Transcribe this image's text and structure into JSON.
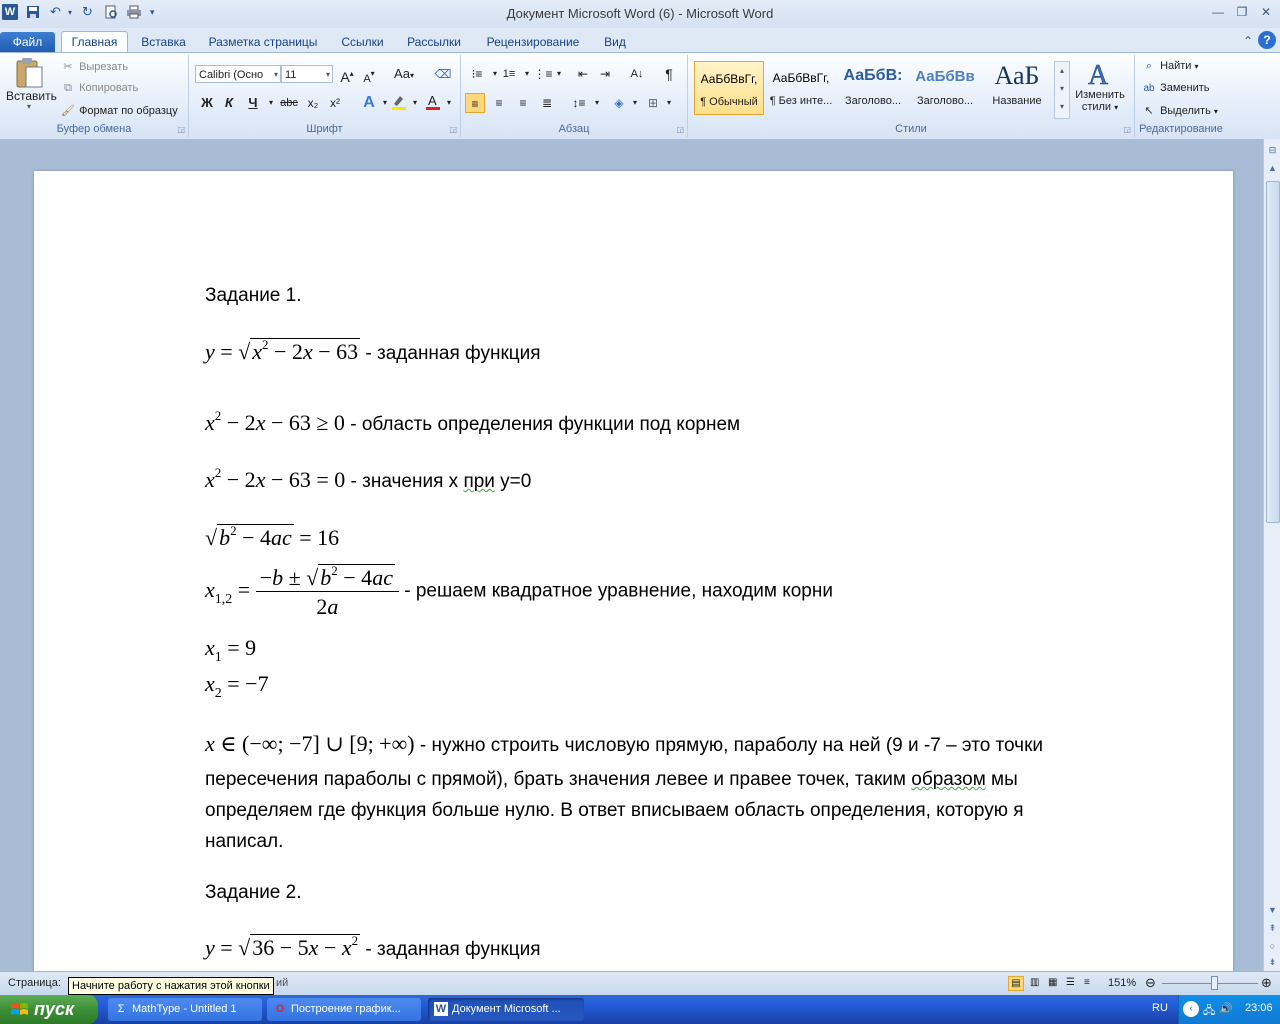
{
  "window": {
    "title": "Документ Microsoft Word (6)  -  Microsoft Word",
    "app_icon": "W",
    "controls": {
      "minimize": "—",
      "restore": "❐",
      "close": "✕"
    }
  },
  "ribbon_tabs": [
    "Файл",
    "Главная",
    "Вставка",
    "Разметка страницы",
    "Ссылки",
    "Рассылки",
    "Рецензирование",
    "Вид"
  ],
  "clipboard": {
    "paste": "Вставить",
    "cut": "Вырезать",
    "copy": "Копировать",
    "format_painter": "Формат по образцу",
    "label": "Буфер обмена"
  },
  "font": {
    "family": "Calibri (Осно",
    "size": "11",
    "label": "Шрифт",
    "bold": "Ж",
    "italic": "К",
    "underline": "Ч",
    "strike": "abc",
    "subscript": "x₂",
    "superscript": "x²",
    "grow": "A",
    "shrink": "A",
    "case": "Aa"
  },
  "paragraph": {
    "label": "Абзац",
    "pilcrow": "¶"
  },
  "styles": {
    "label": "Стили",
    "items": [
      {
        "sample": "АаБбВвГг,",
        "name": "¶ Обычный"
      },
      {
        "sample": "АаБбВвГг,",
        "name": "¶ Без инте..."
      },
      {
        "sample": "АаБбВ:",
        "name": "Заголово..."
      },
      {
        "sample": "АаБбВв",
        "name": "Заголово..."
      },
      {
        "sample": "АаБ",
        "name": "Название"
      }
    ],
    "change": "Изменить стили"
  },
  "editing": {
    "find": "Найти",
    "replace": "Заменить",
    "select": "Выделить",
    "label": "Редактирование"
  },
  "document": {
    "task1_title": "Задание 1.",
    "line1_desc": " - заданная функция",
    "line2_desc": " - область определения функции под корнем",
    "line3_desc_a": " - значения х ",
    "line3_desc_b": "при",
    "line3_desc_c": " у=0",
    "line5_desc": " - решаем квадратное уравнение, находим корни",
    "para_text_1": " - нужно строить числовую прямую, параболу на ней (9 и -7 – это точки",
    "para_text_2a": "пересечения параболы с прямой), брать значения левее и правее точек, таким ",
    "para_text_2b": "образом",
    "para_text_2c": " мы",
    "para_text_3": "определяем где функция больше нулю. В ответ вписываем область определения, которую я",
    "para_text_4": "написал.",
    "task2_title": "Задание 2.",
    "task2_desc": " - заданная функция"
  },
  "statusbar": {
    "page": "Страница:",
    "lang_hidden": "ий",
    "zoom": "151%",
    "tooltip": "Начните работу с нажатия этой кнопки"
  },
  "taskbar": {
    "start": "пуск",
    "tasks": [
      {
        "label": "MathType - Untitled 1",
        "icon": "Σ"
      },
      {
        "label": "Построение график...",
        "icon": "O"
      },
      {
        "label": "Документ Microsoft ...",
        "icon": "W"
      }
    ],
    "lang": "RU",
    "clock": "23:06"
  }
}
